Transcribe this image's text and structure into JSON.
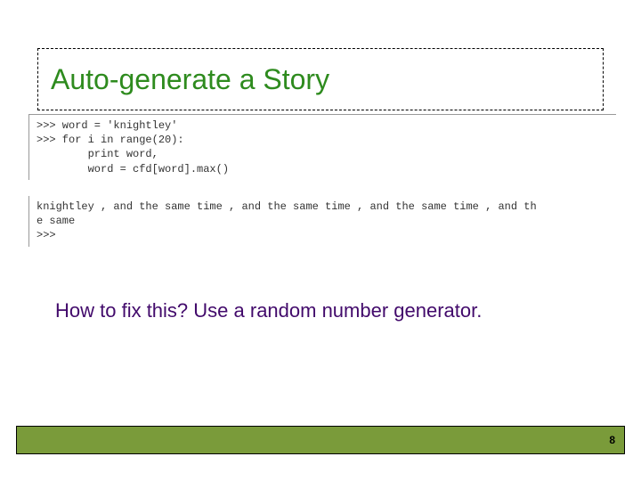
{
  "title": "Auto-generate a Story",
  "code": ">>> word = 'knightley'\n>>> for i in range(20):\n        print word,\n        word = cfd[word].max()",
  "output": "knightley , and the same time , and the same time , and the same time , and th\ne same\n>>>",
  "question": "How to fix this?  Use a random number generator.",
  "page_number": "8"
}
